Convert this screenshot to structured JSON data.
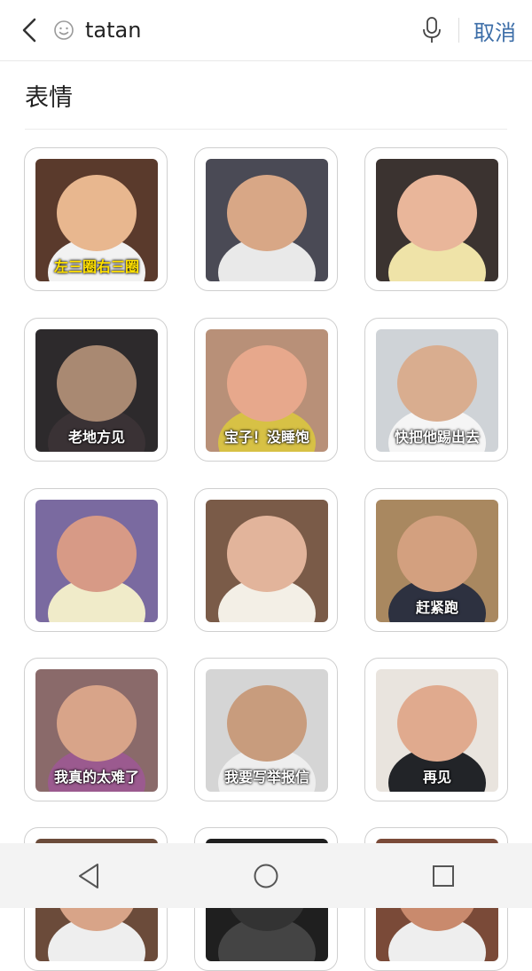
{
  "search": {
    "query": "tatan",
    "cancel_label": "取消"
  },
  "section": {
    "title": "表情"
  },
  "stickers": [
    {
      "caption": "左三圈右三圈",
      "bg": "#5a3a2c",
      "face": "#e8b78f",
      "accent": "#f2f2f2"
    },
    {
      "caption": "",
      "bg": "#4a4a55",
      "face": "#d8a786",
      "accent": "#e9e9e9"
    },
    {
      "caption": "",
      "bg": "#3b3330",
      "face": "#e9b69a",
      "accent": "#efe3a8"
    },
    {
      "caption": "老地方见",
      "bg": "#2d2a2c",
      "face": "#a98972",
      "accent": "#3a3235"
    },
    {
      "caption": "宝子！没睡饱",
      "bg": "#b89078",
      "face": "#e7a88c",
      "accent": "#d7c145"
    },
    {
      "caption": "快把他踢出去",
      "bg": "#cfd3d7",
      "face": "#d9ad8f",
      "accent": "#f5f5f5"
    },
    {
      "caption": "",
      "bg": "#7a6aa0",
      "face": "#d79a86",
      "accent": "#f0ebc9"
    },
    {
      "caption": "",
      "bg": "#7a5b48",
      "face": "#e2b49b",
      "accent": "#f3efe6"
    },
    {
      "caption": "赶紧跑",
      "bg": "#a98860",
      "face": "#d3a07f",
      "accent": "#2d3140"
    },
    {
      "caption": "我真的太难了",
      "bg": "#8a6a6a",
      "face": "#d8a489",
      "accent": "#9b5a8f"
    },
    {
      "caption": "我要写举报信",
      "bg": "#d5d5d5",
      "face": "#c89c7d",
      "accent": "#eeeeee"
    },
    {
      "caption": "再见",
      "bg": "#e9e4de",
      "face": "#e0aa8e",
      "accent": "#222428"
    },
    {
      "caption": "",
      "bg": "#6b4b3a",
      "face": "#d8a488",
      "accent": "#eeeeee"
    },
    {
      "caption": "",
      "bg": "#1f1f1f",
      "face": "#333",
      "accent": "#444"
    },
    {
      "caption": "",
      "bg": "#7a4a38",
      "face": "#c98a6d",
      "accent": "#eeeeee"
    }
  ],
  "icons": {
    "back": "chevron-left-icon",
    "emoji": "smiley-icon",
    "mic": "microphone-icon",
    "nav_back": "triangle-back-icon",
    "nav_home": "circle-home-icon",
    "nav_recents": "square-recents-icon"
  }
}
